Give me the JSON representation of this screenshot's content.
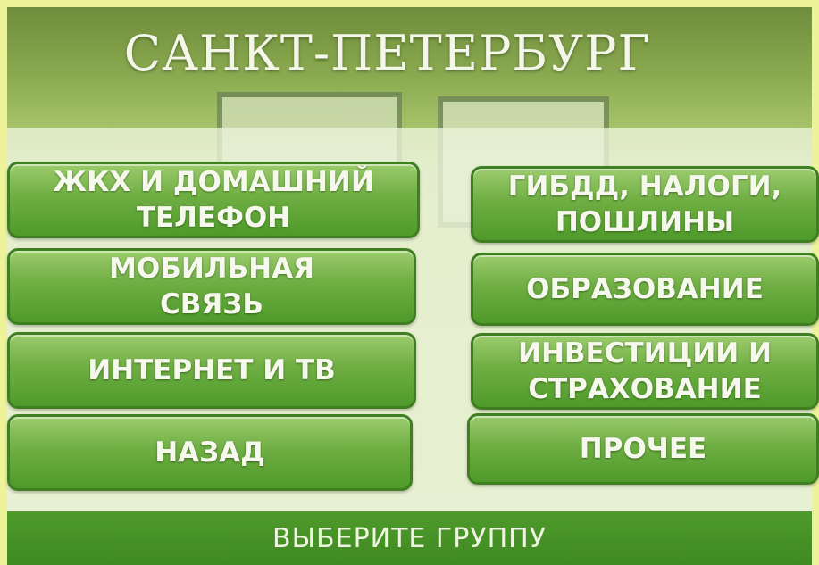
{
  "header": {
    "city": "САНКТ-ПЕТЕРБУРГ"
  },
  "buttons": {
    "housing": "ЖКХ И ДОМАШНИЙ\nТЕЛЕФОН",
    "traffic_police": "ГИБДД, НАЛОГИ,\nПОШЛИНЫ",
    "mobile": "МОБИЛЬНАЯ\nСВЯЗЬ",
    "education": "ОБРАЗОВАНИЕ",
    "internet_tv": "ИНТЕРНЕТ И ТВ",
    "investment": "ИНВЕСТИЦИИ И\nСТРАХОВАНИЕ",
    "back": "НАЗАД",
    "other": "ПРОЧЕЕ"
  },
  "footer": {
    "prompt": "ВЫБЕРИТЕ ГРУППУ"
  },
  "colors": {
    "button_green": "#6fae43",
    "bar_green": "#3f8a22",
    "border": "#eef39a"
  }
}
